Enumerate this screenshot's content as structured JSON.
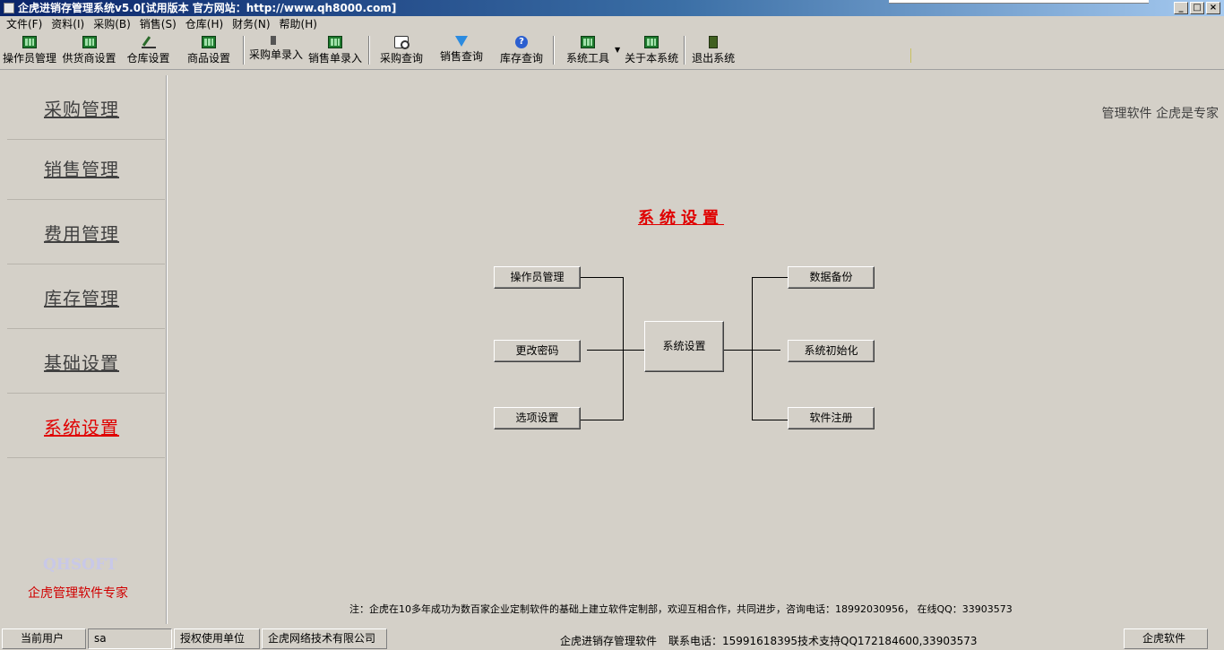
{
  "window": {
    "title": "企虎进销存管理系统v5.0[试用版本 官方网站：http://www.qh8000.com]",
    "controls": [
      "_",
      "□",
      "×"
    ]
  },
  "menu": [
    "文件(F)",
    "资料(I)",
    "采购(B)",
    "销售(S)",
    "仓库(H)",
    "财务(N)",
    "帮助(H)"
  ],
  "toolbar": {
    "operator": "操作员管理",
    "supplier": "供货商设置",
    "warehouse": "仓库设置",
    "product": "商品设置",
    "purchase_entry": "采购单录入",
    "sales_entry": "销售单录入",
    "purchase_query": "采购查询",
    "sales_query": "销售查询",
    "stock_query": "库存查询",
    "tools": "系统工具",
    "about": "关于本系统",
    "exit": "退出系统"
  },
  "sidebar": {
    "items": [
      "采购管理",
      "销售管理",
      "费用管理",
      "库存管理",
      "基础设置",
      "系统设置"
    ],
    "active": "系统设置",
    "brand_en": "QHSOFT",
    "brand_cn": "企虎管理软件专家"
  },
  "main": {
    "slogan": "管理软件  企虎是专家",
    "heading": "系统设置",
    "center_node": "系统设置",
    "left_nodes": [
      "操作员管理",
      "更改密码",
      "选项设置"
    ],
    "right_nodes": [
      "数据备份",
      "系统初始化",
      "软件注册"
    ],
    "note": "注：企虎在10多年成功为数百家企业定制软件的基础上建立软件定制部，欢迎互相合作，共同进步，咨询电话：18992030956，   在线QQ：33903573"
  },
  "statusbar": {
    "user_label": "当前用户",
    "user_value": "sa",
    "licensee_label": "授权使用单位",
    "licensee_value": "企虎网络技术有限公司",
    "product_name": "企虎进销存管理软件",
    "phone": "联系电话：15991618395",
    "support": "技术支持QQ172184600,33903573",
    "vendor": "企虎软件"
  }
}
